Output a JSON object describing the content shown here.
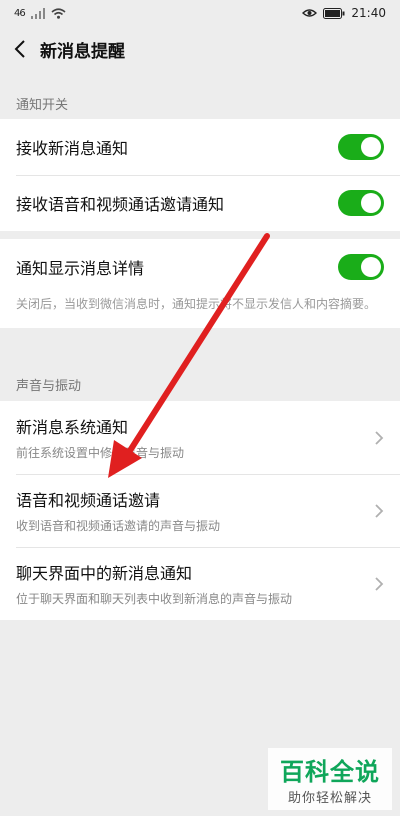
{
  "status_bar": {
    "network": "46",
    "time": "21:40",
    "icons": [
      "signal-icon",
      "wifi-icon",
      "eye-icon",
      "battery-icon"
    ]
  },
  "header": {
    "title": "新消息提醒"
  },
  "sections": {
    "notification_switch": {
      "header": "通知开关",
      "items": [
        {
          "label": "接收新消息通知",
          "toggle": "on"
        },
        {
          "label": "接收语音和视频通话邀请通知",
          "toggle": "on"
        }
      ]
    },
    "detail": {
      "label": "通知显示消息详情",
      "toggle": "on",
      "description": "关闭后，当收到微信消息时，通知提示将不显示发信人和内容摘要。"
    },
    "sound": {
      "header": "声音与振动",
      "items": [
        {
          "title": "新消息系统通知",
          "subtitle": "前往系统设置中修改声音与振动"
        },
        {
          "title": "语音和视频通话邀请",
          "subtitle": "收到语音和视频通话邀请的声音与振动"
        },
        {
          "title": "聊天界面中的新消息通知",
          "subtitle": "位于聊天界面和聊天列表中收到新消息的声音与振动"
        }
      ]
    }
  },
  "watermark": {
    "title": "百科全说",
    "subtitle": "助你轻松解决"
  },
  "colors": {
    "toggle_on": "#1aad19",
    "arrow": "#e02020",
    "background": "#ededed",
    "watermark": "#0fa65a"
  }
}
